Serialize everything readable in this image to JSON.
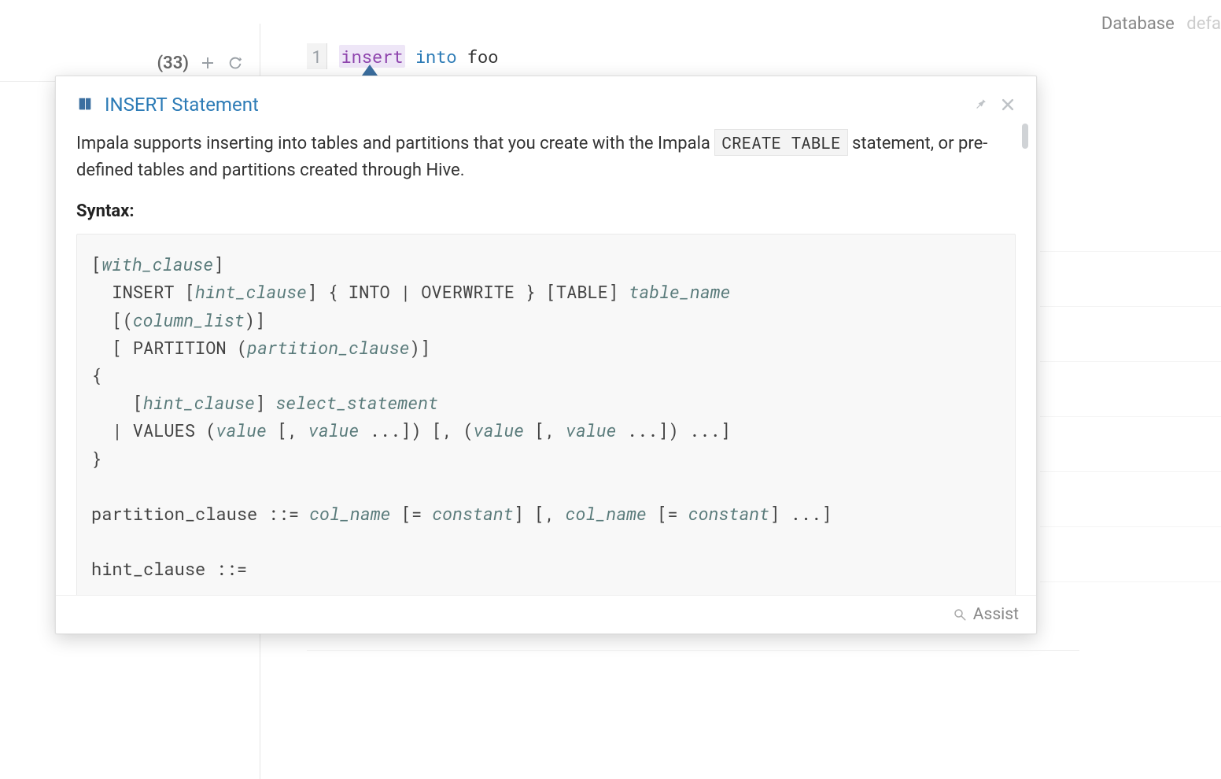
{
  "topbar": {
    "database_label": "Database",
    "database_value": "defa"
  },
  "sidebar": {
    "count_label": "(33)"
  },
  "editor": {
    "line_number": "1",
    "token_insert": "insert",
    "token_into": "into",
    "token_table": "foo"
  },
  "tooltip": {
    "title": "INSERT Statement",
    "description_pre": "Impala supports inserting into tables and partitions that you create with the Impala ",
    "description_code": "CREATE TABLE",
    "description_post": " statement, or pre-defined tables and partitions created through Hive.",
    "syntax_label": "Syntax:",
    "syntax": {
      "l1_open": "[",
      "l1_with": "with_clause",
      "l1_close": "]",
      "l2_insert": "  INSERT [",
      "l2_hint": "hint_clause",
      "l2_mid": "] { INTO | OVERWRITE } [TABLE] ",
      "l2_table": "table_name",
      "l3_open": "  [(",
      "l3_col": "column_list",
      "l3_close": ")]",
      "l4_open": "  [ PARTITION (",
      "l4_part": "partition_clause",
      "l4_close": ")]",
      "l5": "{",
      "l6_open": "    [",
      "l6_hint": "hint_clause",
      "l6_mid": "] ",
      "l6_sel": "select_statement",
      "l7_open": "  | VALUES (",
      "l7_v1": "value",
      "l7_a": " [, ",
      "l7_v2": "value",
      "l7_b": " ...]) [, (",
      "l7_v3": "value",
      "l7_c": " [, ",
      "l7_v4": "value",
      "l7_d": " ...]) ...]",
      "l8": "}",
      "l9_a": "partition_clause ::= ",
      "l9_col1": "col_name",
      "l9_b": " [= ",
      "l9_const1": "constant",
      "l9_c": "] [, ",
      "l9_col2": "col_name",
      "l9_d": " [= ",
      "l9_const2": "constant",
      "l9_e": "] ...]",
      "l10": "hint_clause ::="
    },
    "assist_label": "Assist"
  }
}
